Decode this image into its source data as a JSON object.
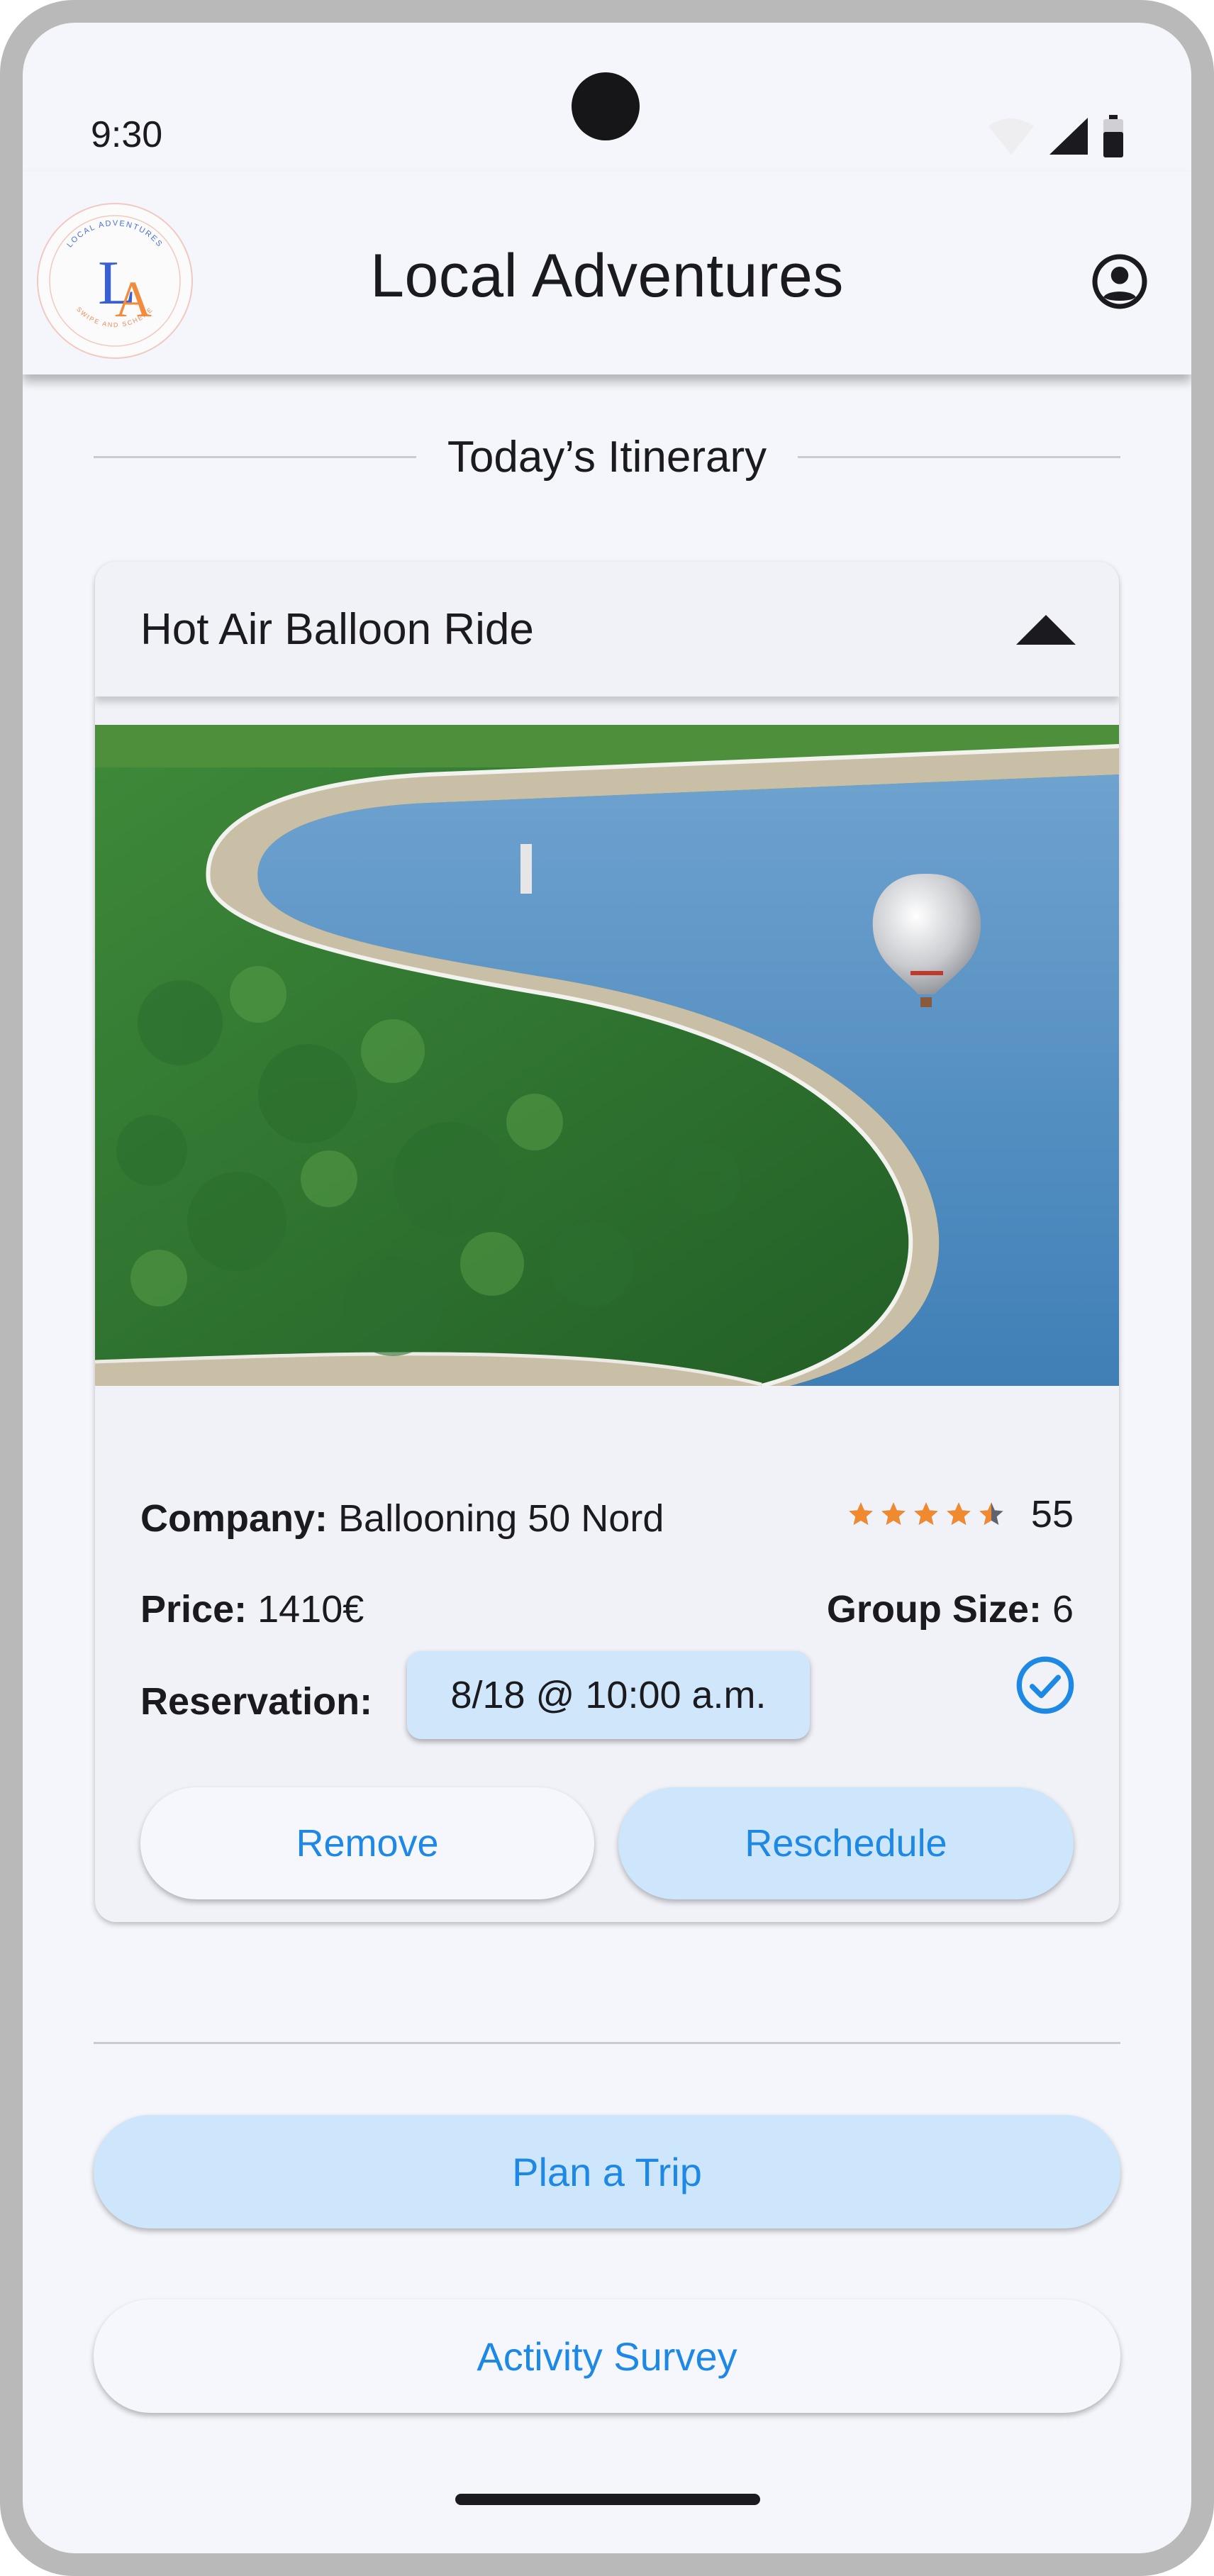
{
  "status_bar": {
    "time": "9:30",
    "icons": [
      "wifi-icon",
      "signal-icon",
      "battery-icon"
    ]
  },
  "app_bar": {
    "title": "Local Adventures",
    "logo": {
      "monogram": "LA",
      "ring_text_top": "LOCAL ADVENTURES",
      "ring_text_bottom": "SWIPE AND SCHEME"
    },
    "account_icon": "account-circle-icon"
  },
  "itinerary": {
    "section_title": "Today’s Itinerary",
    "card": {
      "title": "Hot Air Balloon Ride",
      "expanded": true,
      "image_description_icon": "hot-air-balloon-photo",
      "company_label": "Company:",
      "company_value": "Ballooning 50 Nord",
      "rating": 4.5,
      "rating_max": 5,
      "rating_count": "55",
      "price_label": "Price:",
      "price_value": "1410€",
      "group_size_label": "Group Size:",
      "group_size_value": "6",
      "reservation_label": "Reservation:",
      "reservation_value": "8/18 @ 10:00 a.m.",
      "reservation_confirmed": true,
      "remove_label": "Remove",
      "reschedule_label": "Reschedule"
    }
  },
  "actions": {
    "plan_trip_label": "Plan a Trip",
    "survey_label": "Activity Survey"
  },
  "colors": {
    "accent": "#1e88e5",
    "tonal_button": "#cde6fb",
    "star": "#f18a2f",
    "background": "#f5f6fb"
  }
}
